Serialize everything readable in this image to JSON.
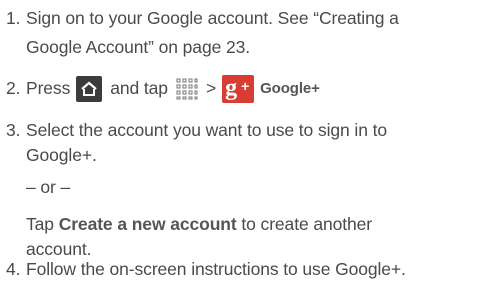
{
  "steps": [
    {
      "number": "1.",
      "lines": [
        "Sign on to your Google account. See “Creating a",
        "Google Account” on page 23."
      ]
    },
    {
      "number": "2.",
      "press_text": "Press",
      "and_tap_text": "and tap",
      "separator": ">",
      "app_label": "Google+",
      "icons": [
        "home-icon",
        "apps-grid-icon",
        "google-plus-icon"
      ],
      "colors": {
        "home_bg": "#3c3c3c",
        "gplus_bg": "#d73d32"
      }
    },
    {
      "number": "3.",
      "lines": [
        "Select the account you want to use to sign in to",
        "Google+."
      ],
      "or_text": "– or –",
      "tap_text": "Tap",
      "create_label": "Create a new account",
      "tap_rest": "to create another",
      "tap_rest_line2": "account."
    },
    {
      "number": "4.",
      "lines": [
        "Follow the on-screen instructions to use Google+."
      ]
    }
  ]
}
